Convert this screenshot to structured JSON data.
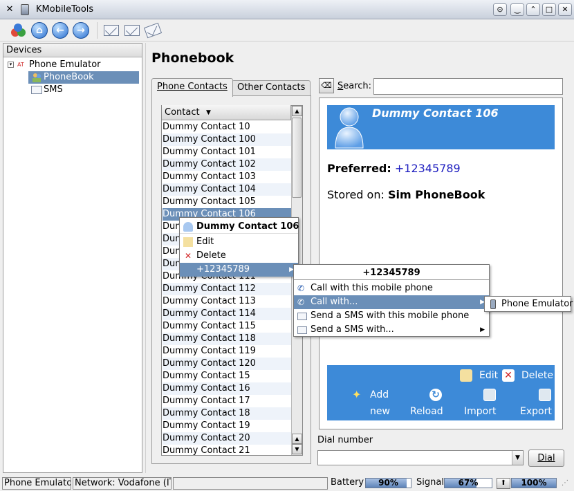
{
  "window": {
    "title": "KMobileTools"
  },
  "toolbar": {
    "icons": [
      "devices-icon",
      "home-icon",
      "back-icon",
      "forward-icon",
      "new-sms-icon",
      "edit-sms-icon",
      "add-sms-icon"
    ]
  },
  "devices": {
    "header": "Devices",
    "tree": [
      {
        "label": "Phone Emulator",
        "badge": "AT"
      },
      {
        "label": "PhoneBook",
        "selected": true
      },
      {
        "label": "SMS"
      }
    ]
  },
  "phonebook": {
    "title": "Phonebook",
    "tabs": [
      "Phone Contacts",
      "Other Contacts"
    ],
    "column_header": "Contact",
    "contacts": [
      "Dummy Contact 10",
      "Dummy Contact 100",
      "Dummy Contact 101",
      "Dummy Contact 102",
      "Dummy Contact 103",
      "Dummy Contact 104",
      "Dummy Contact 105",
      "Dummy Contact 106",
      "Dumm",
      "Dumm",
      "Dumm",
      "Dumm",
      "Dummy Contact 111",
      "Dummy Contact 112",
      "Dummy Contact 113",
      "Dummy Contact 114",
      "Dummy Contact 115",
      "Dummy Contact 118",
      "Dummy Contact 119",
      "Dummy Contact 120",
      "Dummy Contact 15",
      "Dummy Contact 16",
      "Dummy Contact 17",
      "Dummy Contact 18",
      "Dummy Contact 19",
      "Dummy Contact 20",
      "Dummy Contact 21"
    ],
    "selected_index": 7
  },
  "search": {
    "label": "Search:",
    "value": ""
  },
  "detail": {
    "name": "Dummy Contact 106",
    "preferred_label": "Preferred:",
    "preferred_number": "+12345789",
    "stored_label": "Stored on:",
    "stored_value": "Sim PhoneBook",
    "actions": {
      "edit": "Edit",
      "delete": "Delete",
      "add": "Add",
      "add2": "new",
      "reload": "Reload",
      "import": "Import",
      "export": "Export"
    }
  },
  "dial": {
    "label": "Dial number",
    "value": "",
    "button": "Dial"
  },
  "context_menu": {
    "title": "Dummy Contact 106",
    "items": [
      "Edit",
      "Delete",
      "+12345789"
    ]
  },
  "sub_menu": {
    "title": "+12345789",
    "items": [
      "Call with this mobile phone",
      "Call with...",
      "Send a SMS with this mobile phone",
      "Send a SMS with..."
    ]
  },
  "sub_sub_menu": {
    "items": [
      "Phone Emulator"
    ]
  },
  "statusbar": {
    "device": "Phone Emulator",
    "network": "Network: Vodafone (IT)",
    "battery_label": "Battery",
    "battery_value": "90%",
    "battery_level": 0.9,
    "signal_label": "Signal",
    "signal_value": "67%",
    "signal_level": 0.67,
    "third_value": "100%",
    "third_level": 1.0
  },
  "colors": {
    "selection": "#6b8fb8",
    "accent_blue": "#3d8ad8",
    "number_blue": "#2020c0"
  }
}
